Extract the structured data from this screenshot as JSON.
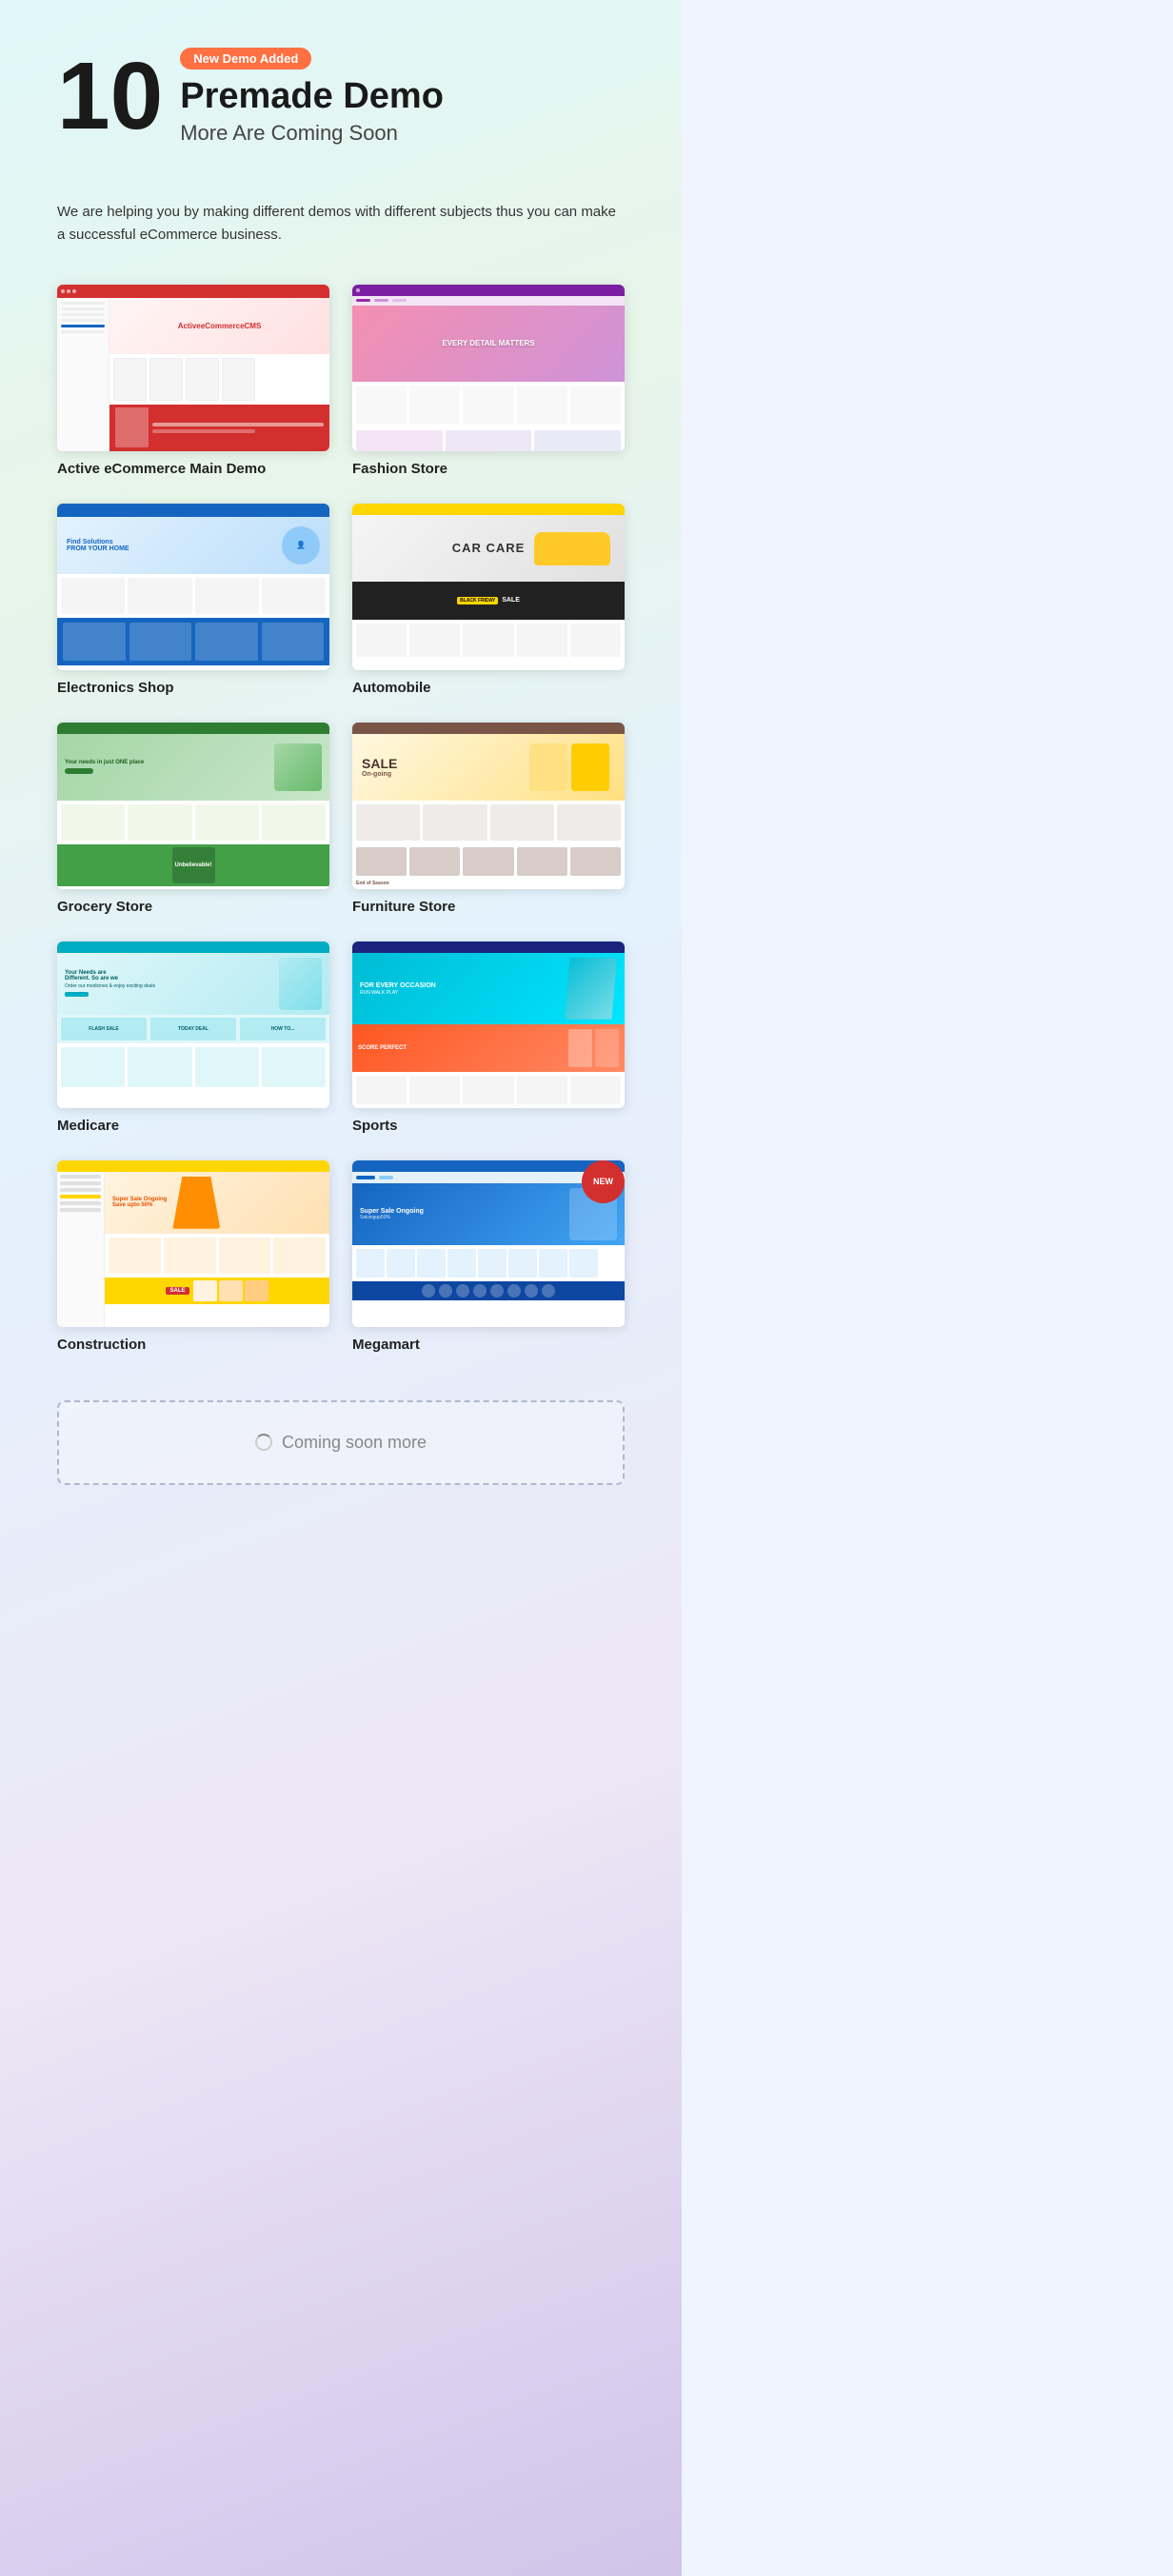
{
  "hero": {
    "number": "10",
    "badge": "New Demo Added",
    "title": "Premade Demo",
    "subtitle": "More Are Coming Soon",
    "description": "We are helping you by making different demos with different subjects thus you can make a successful eCommerce business."
  },
  "demos": [
    {
      "id": "active-main",
      "label": "Active eCommerce Main Demo",
      "type": "active"
    },
    {
      "id": "fashion-store",
      "label": "Fashion Store",
      "type": "fashion"
    },
    {
      "id": "electronics-shop",
      "label": "Electronics Shop",
      "type": "electronics"
    },
    {
      "id": "automobile",
      "label": "Automobile",
      "type": "auto"
    },
    {
      "id": "grocery-store",
      "label": "Grocery Store",
      "type": "grocery"
    },
    {
      "id": "furniture-store",
      "label": "Furniture Store",
      "type": "furniture"
    },
    {
      "id": "medicare",
      "label": "Medicare",
      "type": "medicare"
    },
    {
      "id": "sports",
      "label": "Sports",
      "type": "sports"
    },
    {
      "id": "construction",
      "label": "Construction",
      "type": "construction"
    },
    {
      "id": "megamart",
      "label": "Megamart",
      "type": "megamart",
      "isNew": true
    }
  ],
  "coming_soon": {
    "label": "Coming soon more"
  }
}
